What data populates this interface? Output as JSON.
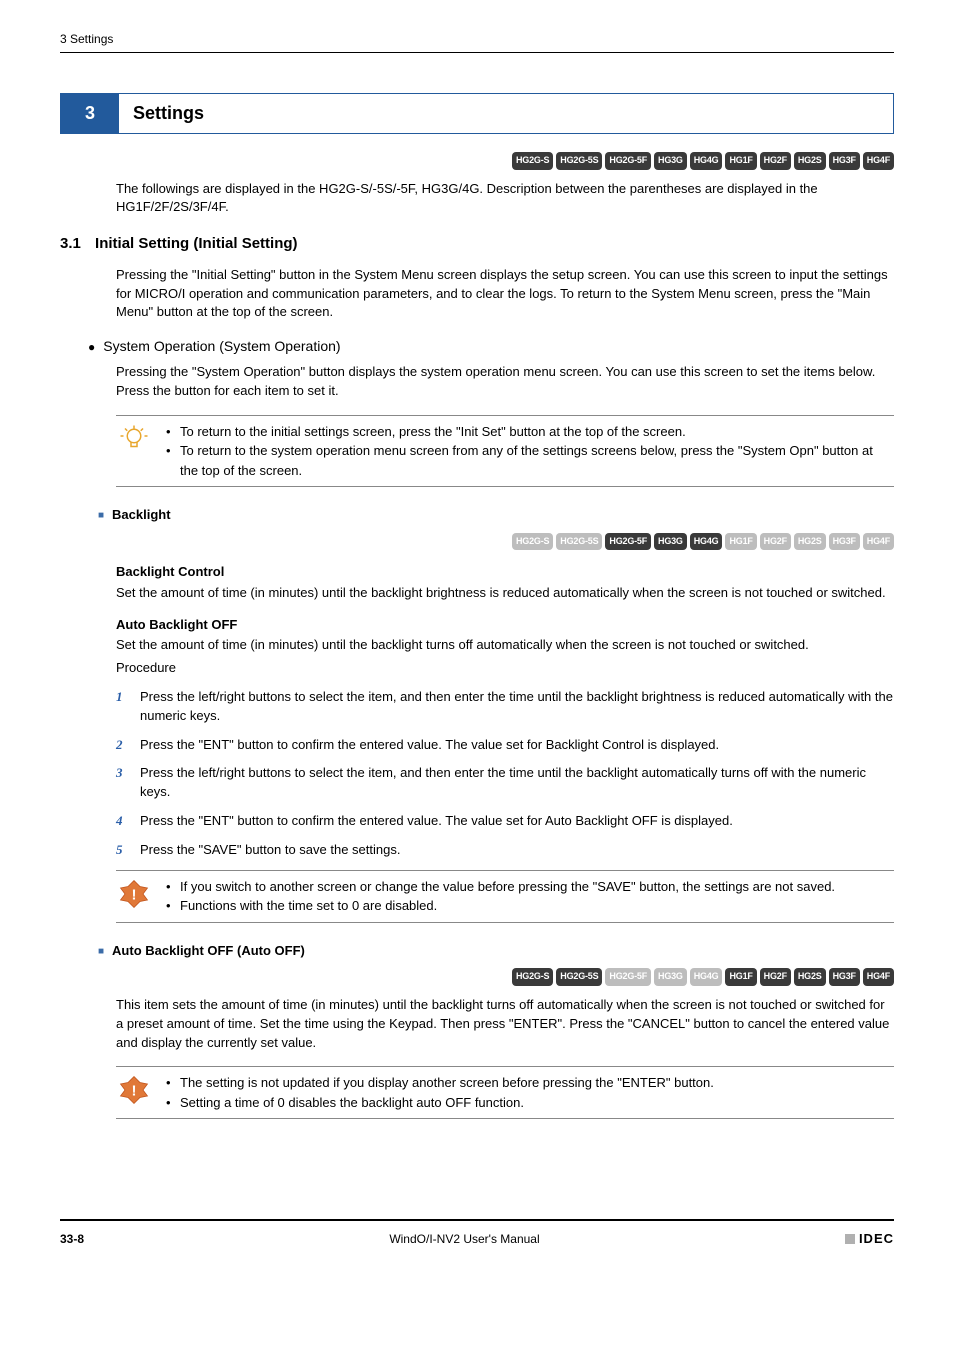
{
  "running_header": "3 Settings",
  "section_number": "3",
  "section_title": "Settings",
  "tag_rows": {
    "row1": [
      {
        "label": "HG2G-S",
        "active": true
      },
      {
        "label": "HG2G-5S",
        "active": true
      },
      {
        "label": "HG2G-5F",
        "active": true
      },
      {
        "label": "HG3G",
        "active": true
      },
      {
        "label": "HG4G",
        "active": true
      },
      {
        "label": "HG1F",
        "active": true
      },
      {
        "label": "HG2F",
        "active": true
      },
      {
        "label": "HG2S",
        "active": true
      },
      {
        "label": "HG3F",
        "active": true
      },
      {
        "label": "HG4F",
        "active": true
      }
    ],
    "row2": [
      {
        "label": "HG2G-S",
        "active": false
      },
      {
        "label": "HG2G-5S",
        "active": false
      },
      {
        "label": "HG2G-5F",
        "active": true
      },
      {
        "label": "HG3G",
        "active": true
      },
      {
        "label": "HG4G",
        "active": true
      },
      {
        "label": "HG1F",
        "active": false
      },
      {
        "label": "HG2F",
        "active": false
      },
      {
        "label": "HG2S",
        "active": false
      },
      {
        "label": "HG3F",
        "active": false
      },
      {
        "label": "HG4F",
        "active": false
      }
    ],
    "row3": [
      {
        "label": "HG2G-S",
        "active": true
      },
      {
        "label": "HG2G-5S",
        "active": true
      },
      {
        "label": "HG2G-5F",
        "active": false
      },
      {
        "label": "HG3G",
        "active": false
      },
      {
        "label": "HG4G",
        "active": false
      },
      {
        "label": "HG1F",
        "active": true
      },
      {
        "label": "HG2F",
        "active": true
      },
      {
        "label": "HG2S",
        "active": true
      },
      {
        "label": "HG3F",
        "active": true
      },
      {
        "label": "HG4F",
        "active": true
      }
    ]
  },
  "intro_text": "The followings are displayed in the HG2G-S/-5S/-5F, HG3G/4G. Description between the parentheses are displayed in the HG1F/2F/2S/3F/4F.",
  "sub_number": "3.1",
  "sub_title": "Initial Setting (Initial Setting)",
  "sub_body": "Pressing the \"Initial Setting\" button in the System Menu screen displays the setup screen. You can use this screen to input the settings for MICRO/I operation and communication parameters, and to clear the logs. To return to the System Menu screen, press the \"Main Menu\" button at the top of the screen.",
  "sysop_title": "System Operation (System Operation)",
  "sysop_body": "Pressing the \"System Operation\" button displays the system operation menu screen. You can use this screen to set the items below. Press the button for each item to set it.",
  "tip_notes": [
    "To return to the initial settings screen, press the \"Init Set\" button at the top of the screen.",
    "To return to the system operation menu screen from any of the settings screens below, press the \"System Opn\" button at the top of the screen."
  ],
  "backlight_heading": "Backlight",
  "backlight_control_term": "Backlight Control",
  "backlight_control_text": "Set the amount of time (in minutes) until the backlight brightness is reduced automatically when the screen is not touched or switched.",
  "auto_backlight_off_term": "Auto Backlight OFF",
  "auto_backlight_off_text": "Set the amount of time (in minutes) until the backlight turns off automatically when the screen is not touched or switched.",
  "procedure_label": "Procedure",
  "procedure_steps": [
    "Press the left/right buttons to select the item, and then enter the time until the backlight brightness is reduced automatically with the numeric keys.",
    "Press the \"ENT\" button to confirm the entered value. The value set for Backlight Control is displayed.",
    "Press the left/right buttons to select the item, and then enter the time until the backlight automatically turns off with the numeric keys.",
    "Press the \"ENT\" button to confirm the entered value. The value set for Auto Backlight OFF is displayed.",
    "Press the \"SAVE\" button to save the settings."
  ],
  "warn_notes1": [
    "If you switch to another screen or change the value before pressing the \"SAVE\" button, the settings are not saved.",
    "Functions with the time set to 0 are disabled."
  ],
  "auto_off_heading": "Auto Backlight OFF (Auto OFF)",
  "auto_off_body": "This item sets the amount of time (in minutes) until the backlight turns off automatically when the screen is not touched or switched for a preset amount of time. Set the time using the Keypad. Then press \"ENTER\". Press the \"CANCEL\" button to cancel the entered value and display the currently set value.",
  "warn_notes2": [
    "The setting is not updated if you display another screen before pressing the  \"ENTER\" button.",
    "Setting a time of 0 disables the backlight auto OFF function."
  ],
  "footer": {
    "page": "33-8",
    "manual": "WindO/I-NV2 User's Manual",
    "logo": "IDEC"
  }
}
